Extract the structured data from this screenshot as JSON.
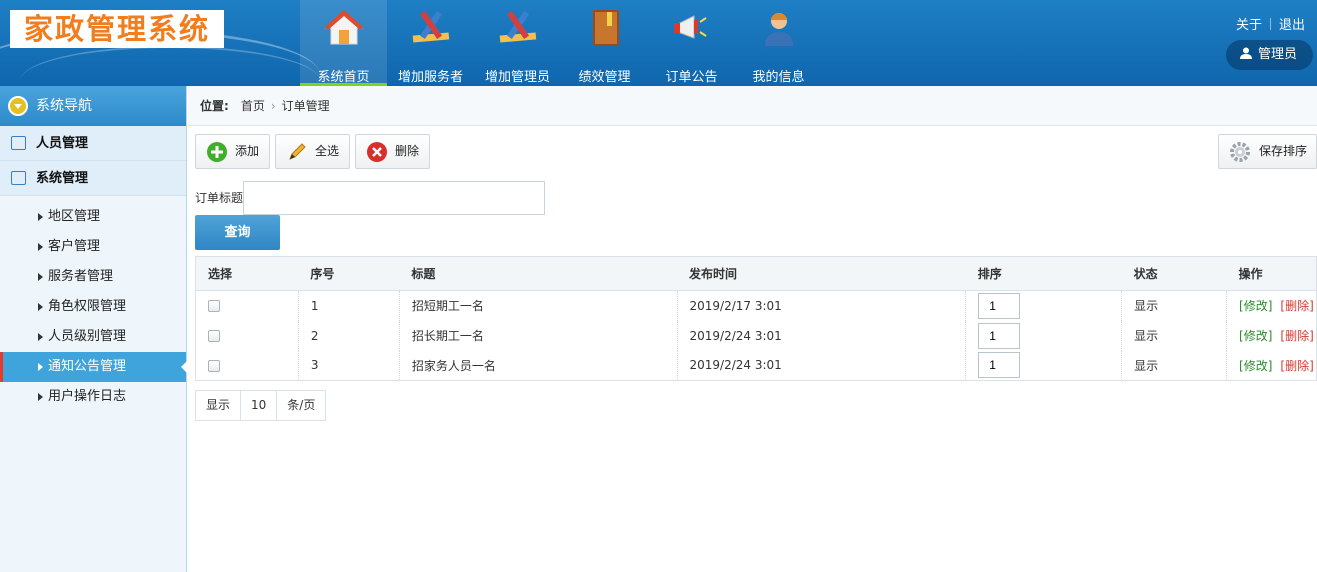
{
  "app": {
    "logo_text": "家政管理系统"
  },
  "nav": [
    {
      "label": "系统首页",
      "icon": "home-icon",
      "active": true
    },
    {
      "label": "增加服务者",
      "icon": "pencil-ruler-icon"
    },
    {
      "label": "增加管理员",
      "icon": "pencil-ruler-icon"
    },
    {
      "label": "绩效管理",
      "icon": "book-icon"
    },
    {
      "label": "订单公告",
      "icon": "megaphone-icon"
    },
    {
      "label": "我的信息",
      "icon": "user-icon"
    }
  ],
  "top_links": {
    "about": "关于",
    "logout": "退出"
  },
  "user": {
    "name": "管理员"
  },
  "sidebar": {
    "title": "系统导航",
    "groups": [
      {
        "label": "人员管理",
        "icon": "list-icon"
      },
      {
        "label": "系统管理",
        "icon": "calendar-icon"
      }
    ],
    "items": [
      {
        "label": "地区管理"
      },
      {
        "label": "客户管理"
      },
      {
        "label": "服务者管理"
      },
      {
        "label": "角色权限管理"
      },
      {
        "label": "人员级别管理"
      },
      {
        "label": "通知公告管理",
        "active": true
      },
      {
        "label": "用户操作日志"
      }
    ]
  },
  "breadcrumb": {
    "prefix": "位置:",
    "home": "首页",
    "current": "订单管理"
  },
  "toolbar": {
    "add": "添加",
    "select_all": "全选",
    "delete": "删除",
    "save_sort": "保存排序"
  },
  "search": {
    "label": "订单标题",
    "value": "",
    "button": "查询"
  },
  "table": {
    "headers": [
      "选择",
      "序号",
      "标题",
      "发布时间",
      "排序",
      "状态",
      "操作"
    ],
    "rows": [
      {
        "no": "1",
        "title": "招短期工一名",
        "time": "2019/2/17 3:01",
        "sort": "1",
        "status": "显示"
      },
      {
        "no": "2",
        "title": "招长期工一名",
        "time": "2019/2/24 3:01",
        "sort": "1",
        "status": "显示"
      },
      {
        "no": "3",
        "title": "招家务人员一名",
        "time": "2019/2/24 3:01",
        "sort": "1",
        "status": "显示"
      }
    ],
    "edit_label": "[修改]",
    "delete_label": "[删除]"
  },
  "pager": {
    "prefix": "显示",
    "page_size": "10",
    "suffix": "条/页"
  },
  "colors": {
    "header": "#0f66ad",
    "accent": "#3fa4dc",
    "active_underline": "#7ed321",
    "danger": "#d23b2f",
    "success": "#2a8a2a"
  }
}
